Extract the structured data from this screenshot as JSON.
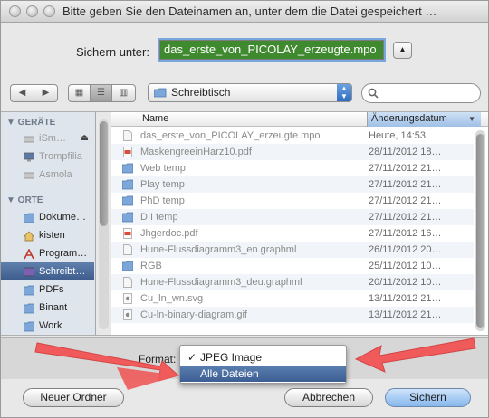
{
  "window": {
    "title": "Bitte geben Sie den Dateinamen an, unter dem die Datei gespeichert …"
  },
  "save": {
    "label": "Sichern unter:",
    "value": "das_erste_von_PICOLAY_erzeugte.mpo",
    "expand_glyph": "▲"
  },
  "toolbar": {
    "back_glyph": "◀",
    "forward_glyph": "▶",
    "view_icon_glyph": "▦",
    "view_list_glyph": "☰",
    "view_column_glyph": "▥",
    "location": "Schreibtisch",
    "search_placeholder": ""
  },
  "sidebar": {
    "devices_header": "▼ GERÄTE",
    "places_header": "▼ ORTE",
    "devices": [
      {
        "label": "iSm…",
        "icon": "disk-icon"
      },
      {
        "label": "Trompfilia",
        "icon": "monitor-icon"
      },
      {
        "label": "Asmola",
        "icon": "disk-icon"
      }
    ],
    "places": [
      {
        "label": "Dokume…",
        "icon": "folder-icon"
      },
      {
        "label": "kisten",
        "icon": "home-icon"
      },
      {
        "label": "Program…",
        "icon": "applications-icon"
      },
      {
        "label": "Schreibt…",
        "icon": "desktop-icon",
        "selected": true
      },
      {
        "label": "PDFs",
        "icon": "folder-icon"
      },
      {
        "label": "Binant",
        "icon": "folder-icon"
      },
      {
        "label": "Work",
        "icon": "folder-icon"
      }
    ]
  },
  "files": {
    "col_name": "Name",
    "col_date": "Änderungsdatum",
    "sort_glyph": "▼",
    "rows": [
      {
        "name": "das_erste_von_PICOLAY_erzeugte.mpo",
        "date": "Heute, 14:53",
        "icon": "document-icon"
      },
      {
        "name": "MaskengreeinHarz10.pdf",
        "date": "28/11/2012 18…",
        "icon": "pdf-icon"
      },
      {
        "name": "Web temp",
        "date": "27/11/2012 21…",
        "icon": "folder-icon"
      },
      {
        "name": "Play temp",
        "date": "27/11/2012 21…",
        "icon": "folder-icon"
      },
      {
        "name": "PhD temp",
        "date": "27/11/2012 21…",
        "icon": "folder-icon"
      },
      {
        "name": "DII temp",
        "date": "27/11/2012 21…",
        "icon": "folder-icon"
      },
      {
        "name": "Jhgerdoc.pdf",
        "date": "27/11/2012 16…",
        "icon": "pdf-icon"
      },
      {
        "name": "Hune-Flussdiagramm3_en.graphml",
        "date": "26/11/2012 20…",
        "icon": "document-icon"
      },
      {
        "name": "RGB",
        "date": "25/11/2012 10…",
        "icon": "folder-icon"
      },
      {
        "name": "Hune-Flussdiagramm3_deu.graphml",
        "date": "20/11/2012 10…",
        "icon": "document-icon"
      },
      {
        "name": "Cu_ln_wn.svg",
        "date": "13/11/2012 21…",
        "icon": "image-icon"
      },
      {
        "name": "Cu-ln-binary-diagram.gif",
        "date": "13/11/2012 21…",
        "icon": "image-icon"
      }
    ]
  },
  "format": {
    "label": "Format:",
    "options": [
      {
        "label": "JPEG Image",
        "checked": true,
        "highlighted": false
      },
      {
        "label": "Alle Dateien",
        "checked": false,
        "highlighted": true
      }
    ],
    "check_glyph": "✓"
  },
  "buttons": {
    "new_folder": "Neuer Ordner",
    "cancel": "Abbrechen",
    "save": "Sichern"
  },
  "colors": {
    "accent_arrow": "#f05a5a",
    "selection": "#3d5c8d",
    "filename_highlight": "#3f8a2f"
  }
}
